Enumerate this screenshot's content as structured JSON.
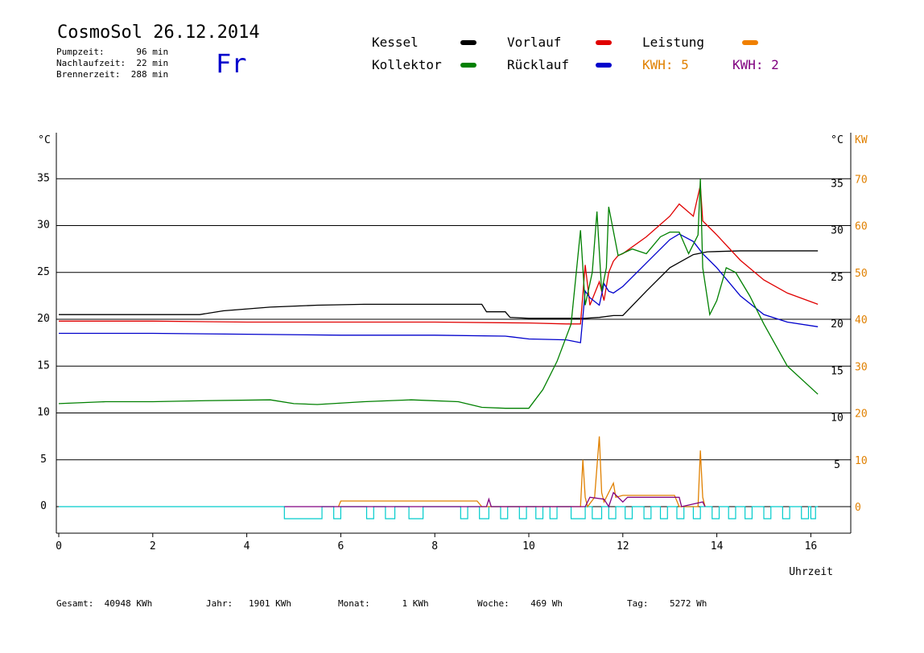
{
  "header": {
    "title": "CosmoSol 26.12.2014",
    "weekday": "Fr",
    "pump_time": "Pumpzeit:      96 min",
    "run_on_time": "Nachlaufzeit:  22 min",
    "burner_time": "Brennerzeit:  288 min"
  },
  "legend": {
    "kessel": {
      "label": "Kessel",
      "color": "#000000"
    },
    "kollektor": {
      "label": "Kollektor",
      "color": "#008000"
    },
    "vorlauf": {
      "label": "Vorlauf",
      "color": "#e00000"
    },
    "ruecklauf": {
      "label": "Rücklauf",
      "color": "#0000cc"
    },
    "leistung": {
      "label": "Leistung",
      "color": "#f08000"
    },
    "kwh1": {
      "label": "KWH: 5",
      "color": "#e08000"
    },
    "kwh2": {
      "label": "KWH: 2",
      "color": "#800080"
    }
  },
  "footer": {
    "gesamt": "Gesamt:  40948 KWh",
    "jahr": "Jahr:   1901 KWh",
    "monat": "Monat:      1 KWh",
    "woche": "Woche:    469 Wh",
    "tag": "Tag:    5272 Wh"
  },
  "chart_data": {
    "type": "line",
    "xlabel": "Uhrzeit",
    "ylabel_left": "°C",
    "ylabel_right_temp": "°C",
    "ylabel_right_power": "KW",
    "xlim": [
      0,
      16.8
    ],
    "ylim": [
      -3,
      40
    ],
    "x_ticks": [
      0,
      2,
      4,
      6,
      8,
      10,
      12,
      14,
      16
    ],
    "y_ticks_left": [
      0,
      5,
      10,
      15,
      20,
      25,
      30,
      35
    ],
    "y_ticks_right_temp": [
      5,
      10,
      15,
      20,
      25,
      30,
      35
    ],
    "y_ticks_right_power": [
      0,
      10,
      20,
      30,
      40,
      50,
      60,
      70
    ],
    "hgrid": [
      5,
      10,
      15,
      20,
      25,
      30,
      35
    ],
    "colors": {
      "pump": "#00cccc"
    },
    "series": [
      {
        "key": "kessel",
        "color": "#000000",
        "x": [
          0,
          3.0,
          3.5,
          4.5,
          5.5,
          6.5,
          7.5,
          8.5,
          9.0,
          9.1,
          9.5,
          9.6,
          10.0,
          10.8,
          11.2,
          11.5,
          11.8,
          12.0,
          12.5,
          13.0,
          13.5,
          13.8,
          14.5,
          15.5,
          16.15
        ],
        "y": [
          20.5,
          20.5,
          20.9,
          21.3,
          21.5,
          21.6,
          21.6,
          21.6,
          21.6,
          20.8,
          20.8,
          20.2,
          20.1,
          20.1,
          20.1,
          20.2,
          20.4,
          20.4,
          23.0,
          25.5,
          26.9,
          27.2,
          27.3,
          27.3,
          27.3
        ]
      },
      {
        "key": "vorlauf",
        "color": "#e00000",
        "x": [
          0,
          2.0,
          4.0,
          6.0,
          8.0,
          10.0,
          10.8,
          11.1,
          11.2,
          11.3,
          11.5,
          11.6,
          11.7,
          11.8,
          11.9,
          12.0,
          12.5,
          13.0,
          13.2,
          13.5,
          13.65,
          13.7,
          14.0,
          14.5,
          15.0,
          15.5,
          16.15
        ],
        "y": [
          19.8,
          19.8,
          19.7,
          19.7,
          19.7,
          19.6,
          19.5,
          19.5,
          25.8,
          21.5,
          24.0,
          22.0,
          25.0,
          26.2,
          26.8,
          27.0,
          28.8,
          31.0,
          32.3,
          31.0,
          34.3,
          30.5,
          29.0,
          26.3,
          24.2,
          22.8,
          21.6
        ]
      },
      {
        "key": "ruecklauf",
        "color": "#0000cc",
        "x": [
          0,
          2.0,
          4.0,
          6.0,
          8.0,
          9.5,
          10.0,
          10.8,
          11.1,
          11.2,
          11.3,
          11.5,
          11.6,
          11.7,
          11.8,
          12.0,
          12.5,
          13.0,
          13.2,
          13.5,
          13.7,
          14.0,
          14.5,
          15.0,
          15.5,
          16.15
        ],
        "y": [
          18.5,
          18.5,
          18.4,
          18.3,
          18.3,
          18.2,
          17.9,
          17.8,
          17.5,
          23.0,
          22.3,
          21.5,
          23.8,
          23.0,
          22.8,
          23.5,
          26.0,
          28.5,
          29.1,
          28.3,
          27.0,
          25.5,
          22.5,
          20.5,
          19.7,
          19.2
        ]
      },
      {
        "key": "kollektor",
        "color": "#008000",
        "x": [
          0,
          1.0,
          2.0,
          3.0,
          4.5,
          5.0,
          5.5,
          6.5,
          7.5,
          8.5,
          9.0,
          9.5,
          10.0,
          10.3,
          10.6,
          10.9,
          11.1,
          11.2,
          11.35,
          11.45,
          11.55,
          11.65,
          11.7,
          11.9,
          12.2,
          12.5,
          12.8,
          13.0,
          13.2,
          13.4,
          13.6,
          13.65,
          13.7,
          13.85,
          14.0,
          14.2,
          14.4,
          14.7,
          15.0,
          15.5,
          16.15
        ],
        "y": [
          11.0,
          11.2,
          11.2,
          11.3,
          11.4,
          11.0,
          10.9,
          11.2,
          11.4,
          11.2,
          10.6,
          10.5,
          10.5,
          12.5,
          15.5,
          19.5,
          29.5,
          21.5,
          25.0,
          31.5,
          23.0,
          25.5,
          32.0,
          26.8,
          27.5,
          27.0,
          28.8,
          29.3,
          29.3,
          27.0,
          29.0,
          35.0,
          25.5,
          20.5,
          22.0,
          25.5,
          25.0,
          22.5,
          19.5,
          15.0,
          12.0
        ]
      }
    ],
    "power_series": [
      {
        "key": "leistung",
        "color": "#e08000",
        "x": [
          5.95,
          6.0,
          8.9,
          9.0,
          11.1,
          11.15,
          11.2,
          11.25,
          11.4,
          11.5,
          11.55,
          11.6,
          11.8,
          11.85,
          12.0,
          13.1,
          13.2,
          13.6,
          13.65,
          13.7,
          13.75
        ],
        "y": [
          0,
          0.6,
          0.6,
          0,
          0,
          5.0,
          1.0,
          0,
          1.0,
          7.5,
          1.5,
          0.5,
          2.5,
          1.0,
          1.2,
          1.2,
          0,
          0,
          6.0,
          1.0,
          0
        ]
      },
      {
        "key": "kwh2",
        "color": "#800080",
        "x": [
          4.8,
          5.5,
          9.1,
          9.15,
          9.2,
          11.2,
          11.3,
          11.6,
          11.7,
          11.8,
          12.0,
          12.1,
          13.2,
          13.25,
          13.7,
          13.75
        ],
        "y": [
          0,
          0,
          0,
          0.8,
          0,
          0,
          1.0,
          0.8,
          0,
          1.5,
          0.5,
          1.0,
          1.0,
          0,
          0.5,
          0
        ]
      }
    ],
    "pump_intervals": [
      [
        4.8,
        5.6
      ],
      [
        5.85,
        6.0
      ],
      [
        6.55,
        6.7
      ],
      [
        6.95,
        7.15
      ],
      [
        7.45,
        7.75
      ],
      [
        8.55,
        8.7
      ],
      [
        8.95,
        9.15
      ],
      [
        9.4,
        9.55
      ],
      [
        9.8,
        9.95
      ],
      [
        10.15,
        10.3
      ],
      [
        10.45,
        10.6
      ],
      [
        10.9,
        11.2
      ],
      [
        11.35,
        11.55
      ],
      [
        11.7,
        11.85
      ],
      [
        12.05,
        12.2
      ],
      [
        12.45,
        12.6
      ],
      [
        12.8,
        12.95
      ],
      [
        13.15,
        13.3
      ],
      [
        13.5,
        13.65
      ],
      [
        13.9,
        14.05
      ],
      [
        14.25,
        14.4
      ],
      [
        14.6,
        14.75
      ],
      [
        15.0,
        15.15
      ],
      [
        15.4,
        15.55
      ],
      [
        15.8,
        15.95
      ],
      [
        16.0,
        16.1
      ]
    ]
  }
}
